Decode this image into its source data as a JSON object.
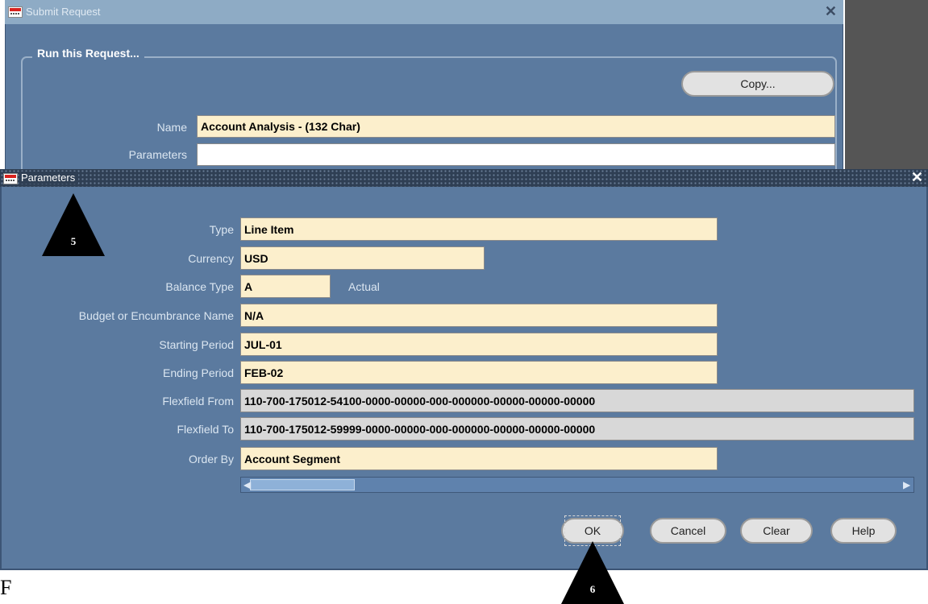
{
  "submit_window": {
    "title": "Submit Request",
    "group_label": "Run this Request...",
    "copy_button": "Copy...",
    "name_label": "Name",
    "name_value": "Account Analysis - (132 Char)",
    "parameters_label": "Parameters",
    "parameters_value": ""
  },
  "parameters_window": {
    "title": "Parameters",
    "fields": {
      "type": {
        "label": "Type",
        "value": "Line Item"
      },
      "currency": {
        "label": "Currency",
        "value": "USD"
      },
      "balance_type": {
        "label": "Balance Type",
        "value": "A",
        "description": "Actual"
      },
      "budget": {
        "label": "Budget or Encumbrance Name",
        "value": "N/A"
      },
      "starting_period": {
        "label": "Starting Period",
        "value": "JUL-01"
      },
      "ending_period": {
        "label": "Ending Period",
        "value": "FEB-02"
      },
      "flexfield_from": {
        "label": "Flexfield From",
        "value": "110-700-175012-54100-0000-00000-000-000000-00000-00000-00000"
      },
      "flexfield_to": {
        "label": "Flexfield To",
        "value": "110-700-175012-59999-0000-00000-000-000000-00000-00000-00000"
      },
      "order_by": {
        "label": "Order By",
        "value": "Account Segment"
      }
    },
    "buttons": {
      "ok": "OK",
      "cancel": "Cancel",
      "clear": "Clear",
      "help": "Help"
    }
  },
  "callouts": {
    "step5": "5",
    "step6": "6"
  },
  "caption": "F"
}
